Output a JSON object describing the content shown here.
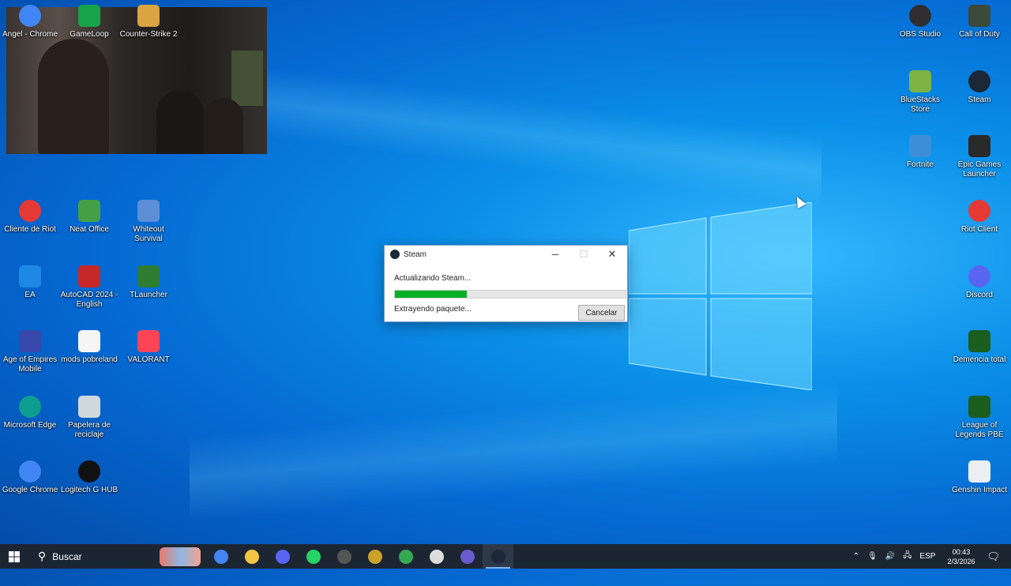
{
  "desktop": {
    "icons_left": [
      {
        "label": "Angel - Chrome",
        "icon": "chrome-icon",
        "color": "#4285f4"
      },
      {
        "label": "GameLoop",
        "icon": "gameloop-icon",
        "color": "#16a34a"
      },
      {
        "label": "Counter-Strike 2",
        "icon": "cs2-icon",
        "color": "#d9a441"
      },
      {
        "label": "Cliente de Riot",
        "icon": "riot-icon",
        "color": "#e53935"
      },
      {
        "label": "Neat Office",
        "icon": "neat-office-icon",
        "color": "#43a047"
      },
      {
        "label": "Whiteout Survival",
        "icon": "whiteout-icon",
        "color": "#5c8fd6"
      },
      {
        "label": "EA",
        "icon": "ea-icon",
        "color": "#1e88e5"
      },
      {
        "label": "AutoCAD 2024 - English",
        "icon": "autocad-icon",
        "color": "#c62828"
      },
      {
        "label": "TLauncher",
        "icon": "tlauncher-icon",
        "color": "#2e7d32"
      },
      {
        "label": "Age of Empires Mobile",
        "icon": "aoe-icon",
        "color": "#3949ab"
      },
      {
        "label": "mods pobreland",
        "icon": "file-icon",
        "color": "#f5f5f5"
      },
      {
        "label": "VALORANT",
        "icon": "valorant-icon",
        "color": "#fd4556"
      },
      {
        "label": "Microsoft Edge",
        "icon": "edge-icon",
        "color": "#0f9d8f"
      },
      {
        "label": "Papelera de reciclaje",
        "icon": "recycle-bin-icon",
        "color": "#cfd8dc"
      },
      {
        "label": "Google Chrome",
        "icon": "chrome-icon",
        "color": "#4285f4"
      },
      {
        "label": "Logitech G HUB",
        "icon": "logitech-icon",
        "color": "#111111"
      }
    ],
    "icons_right": [
      {
        "label": "OBS Studio",
        "icon": "obs-icon",
        "color": "#302e31"
      },
      {
        "label": "Call of Duty",
        "icon": "cod-icon",
        "color": "#3b4a3a"
      },
      {
        "label": "BlueStacks Store",
        "icon": "bluestacks-icon",
        "color": "#7cb342"
      },
      {
        "label": "Steam",
        "icon": "steam-icon",
        "color": "#1b2838"
      },
      {
        "label": "Fortnite",
        "icon": "fortnite-icon",
        "color": "#3d8fd9"
      },
      {
        "label": "Epic Games Launcher",
        "icon": "epic-icon",
        "color": "#2a2a2a"
      },
      {
        "label": "Riot Client",
        "icon": "riot-icon",
        "color": "#e53935"
      },
      {
        "label": "Discord",
        "icon": "discord-icon",
        "color": "#5865f2"
      },
      {
        "label": "Demencia total",
        "icon": "lol-icon",
        "color": "#1b5e20"
      },
      {
        "label": "League of Legends PBE",
        "icon": "lol-pbe-icon",
        "color": "#1b5e20"
      },
      {
        "label": "Genshin Impact",
        "icon": "genshin-icon",
        "color": "#eceff1"
      }
    ]
  },
  "dialog": {
    "title": "Steam",
    "status": "Actualizando Steam...",
    "progress": 0.31,
    "substatus": "Extrayendo paquete...",
    "cancel_label": "Cancelar"
  },
  "taskbar": {
    "search_label": "Buscar",
    "apps": [
      "chrome-icon",
      "file-explorer-icon",
      "discord-icon",
      "whatsapp-icon",
      "obs-icon",
      "game-icon",
      "chrome-profile-icon",
      "steelseries-icon",
      "cortana-icon",
      "steam-icon"
    ],
    "language": "ESP",
    "time": "00:43",
    "date": "2/3/2026"
  }
}
